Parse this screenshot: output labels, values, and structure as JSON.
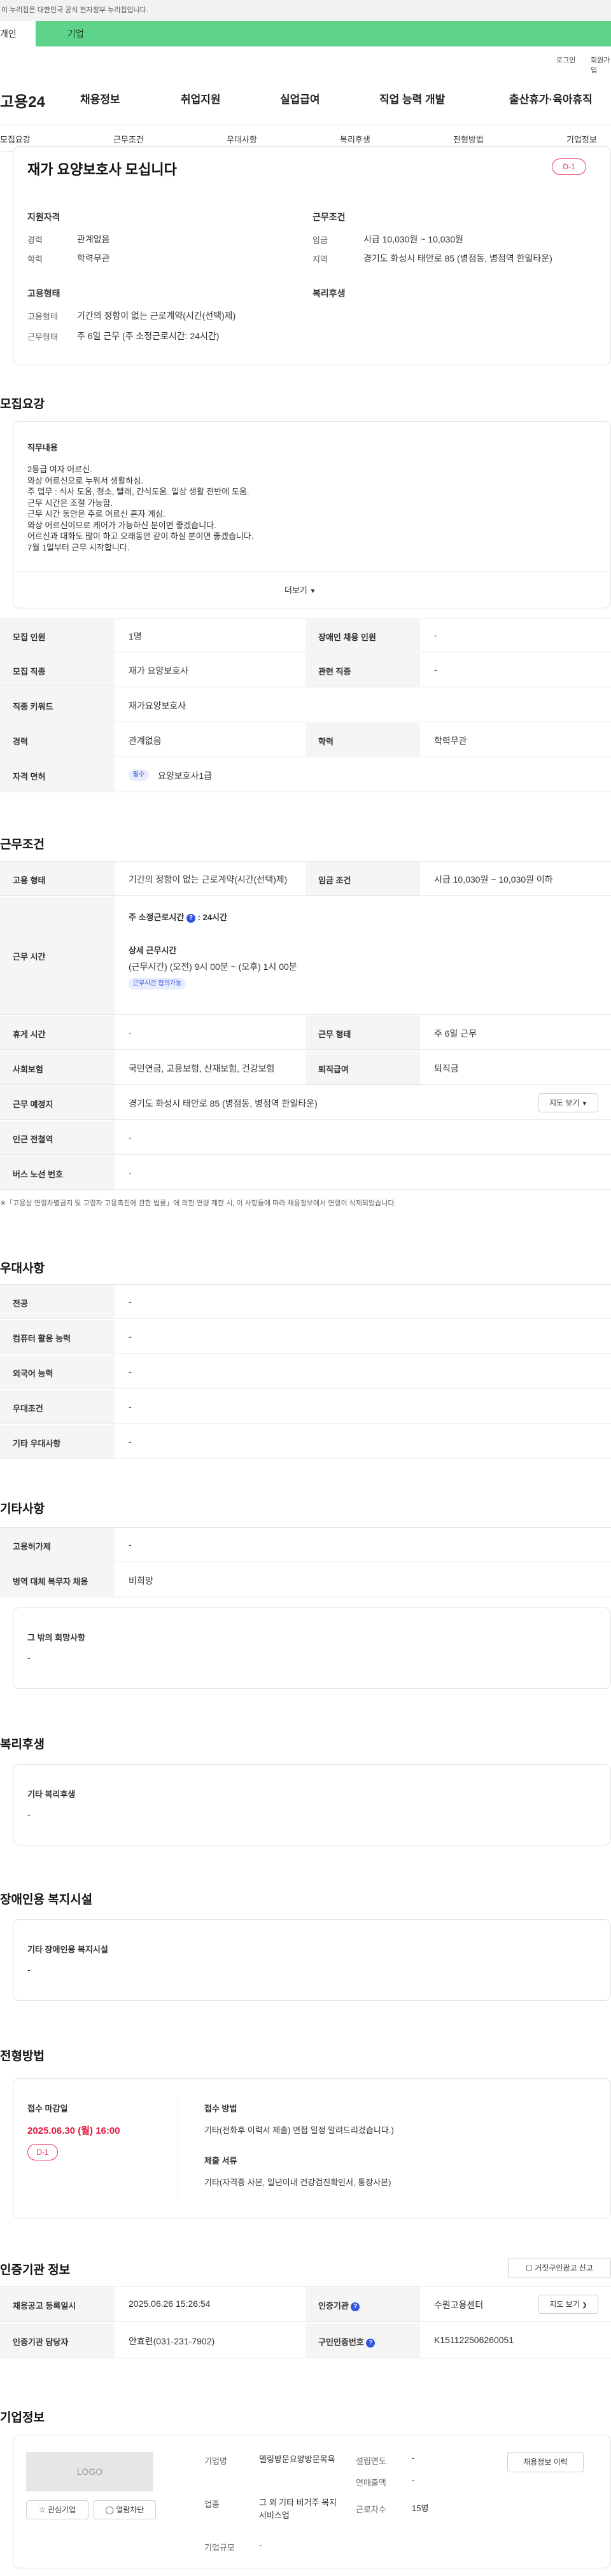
{
  "gov_notice": "이 누리집은 대한민국 공식 전자정부 누리집입니다.",
  "tabs": {
    "person": "개인",
    "business": "기업"
  },
  "util": {
    "login": "로그인",
    "join": "회원가입"
  },
  "brand": "고용24",
  "gnb": [
    "채용정보",
    "취업지원",
    "실업급여",
    "직업 능력 개발",
    "출산휴가·육아휴직"
  ],
  "lnb": [
    "모집요강",
    "근무조건",
    "우대사항",
    "복리후생",
    "전형방법",
    "기업정보"
  ],
  "job": {
    "title": "재가 요양보호사 모십니다",
    "dday": "D-1",
    "qual_title": "지원자격",
    "career_label": "경력",
    "career_value": "관계없음",
    "edu_label": "학력",
    "edu_value": "학력무관",
    "cond_title": "근무조건",
    "wage_label": "임금",
    "wage_value": "시급 10,030원 ~ 10,030원",
    "region_label": "지역",
    "region_value": "경기도 화성시 태안로 85 (병점동, 병점역 한일타운)",
    "emp_title": "고용형태",
    "emptype_label": "고용형태",
    "emptype_value": "기간의 정함이 없는 근로계약(시간(선택)제)",
    "worktype_label": "근무형태",
    "worktype_value": "주 6일 근무 (주 소정근로시간: 24시간)",
    "welfare_title": "복리후생"
  },
  "recruit": {
    "section_title": "모집요강",
    "duty_title": "직무내용",
    "duty_lines": [
      "2등급 여자 어르신.",
      "와상 어르신으로 누워서 생활하심.",
      "주 업무 : 식사 도움, 청소, 빨래, 간식도움. 일상 생활 전반에 도움.",
      "근무 시간은 조절 가능함.",
      "근무 시간 동안은 주로 어르신 혼자 계심.",
      "와상 어르신이므로 케어가 가능하신 분이면 좋겠습니다.",
      "어르신과 대화도 많이 하고 오래동안 같이 하실 분이면 좋겠습니다.",
      "7월 1일부터 근무 시작합니다."
    ],
    "more": "더보기",
    "headcount_label": "모집 인원",
    "headcount_value": "1명",
    "disabled_label": "장애인 채용 인원",
    "disabled_value": "-",
    "job_label": "모집 직종",
    "job_value": "재가 요양보호사",
    "related_label": "관련 직종",
    "related_value": "-",
    "keyword_label": "직종 키워드",
    "keyword_value": "재가요양보호사",
    "career_label": "경력",
    "career_value": "관계없음",
    "edu_label": "학력",
    "edu_value": "학력무관",
    "license_label": "자격 면허",
    "license_chip": "필수",
    "license_value": "요양보호사1급"
  },
  "work": {
    "section_title": "근무조건",
    "emptype_label": "고용 형태",
    "emptype_value": "기간의 정함이 없는 근로계약(시간(선택)제)",
    "wage_label": "임금 조건",
    "wage_value": "시급 10,030원 ~ 10,030원 이하",
    "hours_label": "근무 시간",
    "weekly_label": "주 소정근로시간",
    "weekly_value": ": 24시간",
    "detail_label": "상세 근무시간",
    "detail_value": "(근무시간) (오전) 9시 00분 ~ (오후) 1시 00분",
    "nego_chip": "근무시간 협의가능",
    "rest_label": "휴게 시간",
    "rest_value": "-",
    "form_label": "근무 형태",
    "form_value": "주 6일 근무",
    "insure_label": "사회보험",
    "insure_value": "국민연금, 고용보험, 산재보험, 건강보험",
    "severance_label": "퇴직급여",
    "severance_value": "퇴직금",
    "place_label": "근무 예정지",
    "place_value": "경기도 화성시 태안로 85 (병점동, 병점역 한일타운)",
    "map_btn": "지도 보기",
    "subway_label": "인근 전철역",
    "subway_value": "-",
    "bus_label": "버스 노선 번호",
    "bus_value": "-",
    "note": "※「고용상 연령차별금지 및 고령자 고용촉진에 관한 법률」에 의한 연령 제한 시, 이 사항들에 따라 채용정보에서 연령이 삭제되었습니다."
  },
  "pref": {
    "section_title": "우대사항",
    "rows": [
      {
        "label": "전공",
        "value": "-"
      },
      {
        "label": "컴퓨터 활용 능력",
        "value": "-"
      },
      {
        "label": "외국어 능력",
        "value": "-"
      },
      {
        "label": "우대조건",
        "value": "-"
      },
      {
        "label": "기타 우대사항",
        "value": "-"
      }
    ]
  },
  "etc": {
    "section_title": "기타사항",
    "rows": [
      {
        "label": "고용허가제",
        "value": "-"
      },
      {
        "label": "병역 대체 복무자 채용",
        "value": "비희망"
      }
    ],
    "wish_title": "그 밖의 희망사항",
    "wish_value": "-"
  },
  "welfare": {
    "section_title": "복리후생",
    "box_title": "기타 복리후생",
    "box_value": "-"
  },
  "disabled_fac": {
    "section_title": "장애인용 복지시설",
    "box_title": "기타 장애인용 복지시설",
    "box_value": "-"
  },
  "screening": {
    "section_title": "전형방법",
    "deadline_label": "접수 마감일",
    "deadline_value": "2025.06.30 (월) 16:00",
    "dday": "D-1",
    "method_label": "접수 방법",
    "method_value": "기타(전화후 이력서 제출) 면접 일정 알려드리겠습니다.)",
    "docs_label": "제출 서류",
    "docs_value": "기타(자격증 사본, 일년이내 건강검진확인서, 통장사본)"
  },
  "agency": {
    "section_title": "인증기관 정보",
    "report_btn": "거짓구인광고 신고",
    "regdate_label": "채용공고 등록일시",
    "regdate_value": "2025.06.26 15:26:54",
    "agency_label": "인증기관",
    "agency_value": "수원고용센터",
    "map_btn": "지도 보기",
    "manager_label": "인증기관 담당자",
    "manager_value": "안효련(031-231-7902)",
    "reqno_label": "구인인증번호",
    "reqno_value": "K151122506260051"
  },
  "company": {
    "section_title": "기업정보",
    "logo": "LOGO",
    "fav_btn": "관심기업",
    "block_btn": "열람차단",
    "name_label": "기업명",
    "name_value": "델링방문요양방문목욕",
    "year_label": "설립연도",
    "year_value": "-",
    "sales_label": "연매출액",
    "sales_value": "-",
    "industry_label": "업종",
    "industry_value": "그 외 기타 비거주 복지 서비스업",
    "staff_label": "근로자수",
    "staff_value": "15명",
    "scale_label": "기업규모",
    "scale_value": "-",
    "history_btn": "채용정보 이력"
  }
}
